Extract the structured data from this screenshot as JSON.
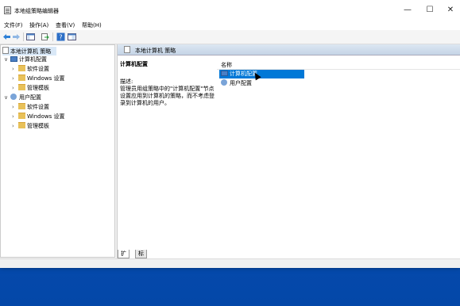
{
  "window": {
    "title": "本地组策略编辑器"
  },
  "window_controls": {
    "minimize": "—",
    "maximize": "☐",
    "close": "✕"
  },
  "menu": [
    "文件(F)",
    "操作(A)",
    "查看(V)",
    "帮助(H)"
  ],
  "toolbar": {
    "icons": [
      "back-icon",
      "forward-icon",
      "show-hide-tree-icon",
      "export-icon",
      "help-icon",
      "properties-icon"
    ]
  },
  "tree": {
    "root": "本地计算机 策略",
    "computer_config": "计算机配置",
    "computer_children": [
      "软件设置",
      "Windows 设置",
      "管理模板"
    ],
    "user_config": "用户配置",
    "user_children": [
      "软件设置",
      "Windows 设置",
      "管理模板"
    ]
  },
  "right": {
    "header": "本地计算机 策略",
    "desc_title": "计算机配置",
    "desc_label": "描述:",
    "desc_text": "管理员用组策略中的\"计算机配置\"节点设置应用到计算机的策略，而不考虑登录到计算机的用户。",
    "column_name": "名称",
    "items": [
      "计算机配置",
      "用户配置"
    ]
  },
  "tabs": [
    "扩展",
    "标准"
  ],
  "colors": {
    "selection": "#0078d7",
    "tree_selection": "#d9e8f7",
    "desktop": "#0a52b8"
  }
}
